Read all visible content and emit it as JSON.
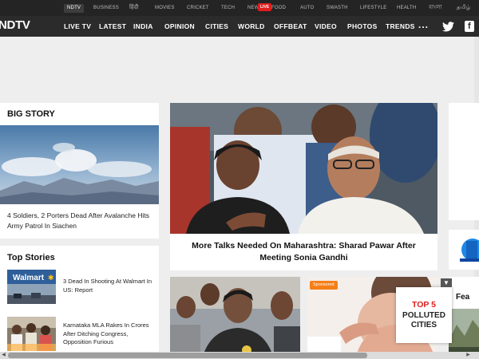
{
  "top_links": [
    "NDTV",
    "BUSINESS",
    "हिंदी",
    "MOVIES",
    "CRICKET",
    "TECH",
    "NEW",
    "FOOD",
    "AUTO",
    "SWASTH",
    "LIFESTYLE",
    "HEALTH",
    "বাংলা",
    "தமிழ்"
  ],
  "top_live_badge": "LIVE",
  "logo": "NDTV",
  "nav": [
    "LIVE TV",
    "LATEST",
    "INDIA",
    "OPINION",
    "CITIES",
    "WORLD",
    "OFFBEAT",
    "VIDEO",
    "PHOTOS",
    "TRENDS",
    "..."
  ],
  "big_story": {
    "section_title": "BIG STORY",
    "caption": "4 Soldiers, 2 Porters Dead After Avalanche Hits Army Patrol In Siachen"
  },
  "lead_story": {
    "caption": "More Talks Needed On Maharashtra: Sharad Pawar After Meeting Sonia Gandhi"
  },
  "top_stories": {
    "section_title": "Top Stories",
    "items": [
      {
        "title": "3 Dead In Shooting At Walmart In US: Report",
        "image_text": "Walmart"
      },
      {
        "title": "Karnataka MLA Rakes In Crores After Ditching Congress, Opposition Furious"
      }
    ]
  },
  "sponsored_label": "Sponsored",
  "feature_label": "Fea",
  "poll_widget": {
    "line1": "TOP 5",
    "line2": "POLLUTED CITIES"
  },
  "colors": {
    "accent": "#e11d1d",
    "nav_bg": "#2b2b2b",
    "strip_bg": "#242424",
    "sponsored": "#f57f17"
  }
}
